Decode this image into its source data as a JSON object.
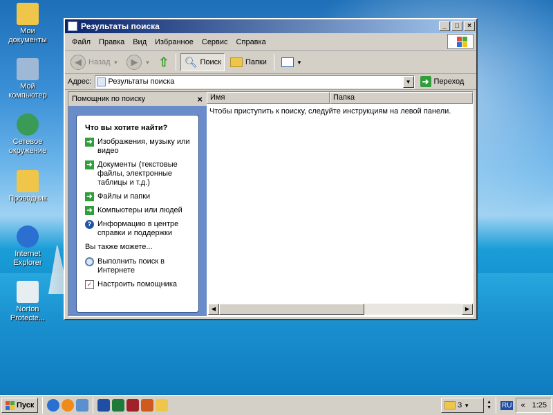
{
  "desktop": {
    "icons": [
      {
        "label_line1": "Мои",
        "label_line2": "документы",
        "icon": "folder-documents-icon",
        "color": "#f0c64a"
      },
      {
        "label_line1": "Мой",
        "label_line2": "компьютер",
        "icon": "computer-icon",
        "color": "#9fb8d6"
      },
      {
        "label_line1": "Сетевое",
        "label_line2": "окружение",
        "icon": "network-icon",
        "color": "#3a9a56"
      },
      {
        "label_line1": "Проводник",
        "label_line2": "",
        "icon": "explorer-icon",
        "color": "#f0c64a"
      },
      {
        "label_line1": "Internet",
        "label_line2": "Explorer",
        "icon": "internet-explorer-icon",
        "color": "#2b6fd1"
      },
      {
        "label_line1": "Norton",
        "label_line2": "Protecte...",
        "icon": "recycle-bin-icon",
        "color": "#e6eef2"
      }
    ]
  },
  "window": {
    "title": "Результаты поиска",
    "controls": {
      "minimize": "_",
      "maximize": "□",
      "close": "×"
    },
    "menu": [
      "Файл",
      "Правка",
      "Вид",
      "Избранное",
      "Сервис",
      "Справка"
    ],
    "toolbar": {
      "back": "Назад",
      "search": "Поиск",
      "folders": "Папки"
    },
    "address": {
      "label": "Адрес:",
      "value": "Результаты поиска",
      "go": "Переход"
    },
    "search_panel": {
      "header": "Помощник по поиску",
      "close": "×",
      "question": "Что вы хотите найти?",
      "options": [
        "Изображения, музыку или видео",
        "Документы (текстовые файлы, электронные таблицы и т.д.)",
        "Файлы и папки",
        "Компьютеры или людей"
      ],
      "help": "Информацию в центре справки и поддержки",
      "also": "Вы также можете...",
      "internet": "Выполнить поиск в Интернете",
      "customize": "Настроить помощника"
    },
    "results": {
      "columns": [
        "Имя",
        "Папка"
      ],
      "message": "Чтобы приступить к поиску, следуйте инструкциям на левой панели."
    }
  },
  "taskbar": {
    "start": "Пуск",
    "group_count": "3",
    "language": "RU",
    "collapse": "«",
    "clock": "1:25"
  }
}
